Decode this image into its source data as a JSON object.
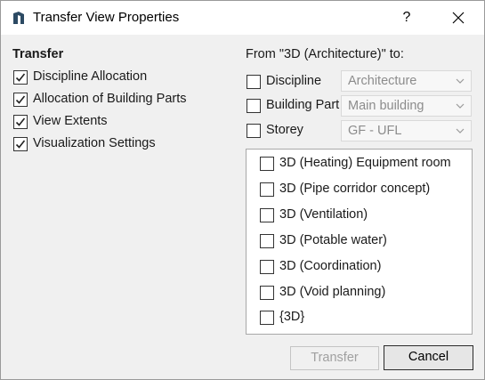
{
  "window": {
    "title": "Transfer View Properties",
    "help_label": "?",
    "icons": {
      "app": "app-logo-icon",
      "close": "close-icon"
    }
  },
  "transfer": {
    "heading": "Transfer",
    "options": [
      {
        "label": "Discipline Allocation",
        "checked": true
      },
      {
        "label": "Allocation of Building Parts",
        "checked": true
      },
      {
        "label": "View Extents",
        "checked": true
      },
      {
        "label": "Visualization Settings",
        "checked": true
      }
    ]
  },
  "target": {
    "heading": "From \"3D (Architecture)\" to:",
    "fields": [
      {
        "label": "Discipline",
        "checked": false,
        "value": "Architecture"
      },
      {
        "label": "Building Part",
        "checked": false,
        "value": "Main building"
      },
      {
        "label": "Storey",
        "checked": false,
        "value": "GF - UFL"
      }
    ],
    "views": [
      {
        "label": "3D (Heating) Equipment room",
        "checked": false
      },
      {
        "label": "3D (Pipe corridor concept)",
        "checked": false
      },
      {
        "label": "3D (Ventilation)",
        "checked": false
      },
      {
        "label": "3D (Potable water)",
        "checked": false
      },
      {
        "label": "3D (Coordination)",
        "checked": false
      },
      {
        "label": "3D (Void planning)",
        "checked": false
      },
      {
        "label": "{3D}",
        "checked": false
      }
    ]
  },
  "buttons": {
    "transfer": "Transfer",
    "cancel": "Cancel"
  },
  "colors": {
    "dialog_bg": "#f0f0f0",
    "titlebar_bg": "#ffffff",
    "disabled_text": "#a0a0a0",
    "logo": "#2c4a63"
  }
}
